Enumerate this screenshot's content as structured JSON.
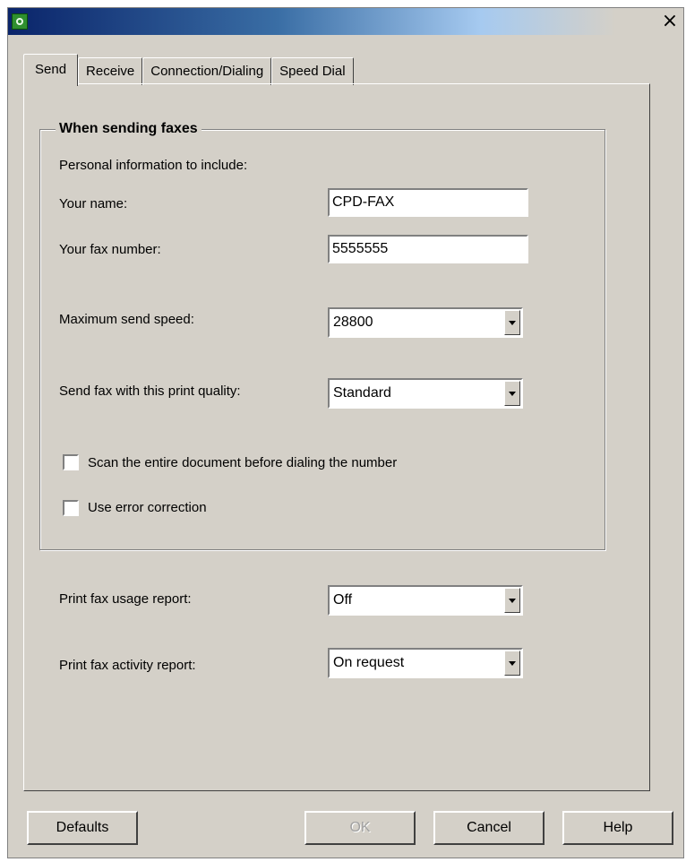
{
  "window": {
    "title": "",
    "app_icon": "fax-app-icon",
    "close_glyph": "×"
  },
  "tabs": [
    {
      "label": "Send",
      "active": true
    },
    {
      "label": "Receive",
      "active": false
    },
    {
      "label": "Connection/Dialing",
      "active": false
    },
    {
      "label": "Speed Dial",
      "active": false
    }
  ],
  "group": {
    "title": "When sending faxes",
    "personal_info_label": "Personal information to include:",
    "your_name_label": "Your name:",
    "your_name_value": "CPD-FAX",
    "fax_number_label": "Your fax number:",
    "fax_number_value": "5555555",
    "max_speed_label": "Maximum send speed:",
    "max_speed_value": "28800",
    "print_quality_label": "Send fax with this print quality:",
    "print_quality_value": "Standard",
    "scan_label": "Scan the entire document before dialing the number",
    "scan_checked": false,
    "error_correction_label": "Use error correction",
    "error_correction_checked": false
  },
  "reports": {
    "usage_label": "Print fax usage report:",
    "usage_value": "Off",
    "activity_label": "Print fax activity report:",
    "activity_value": "On request"
  },
  "buttons": {
    "defaults": "Defaults",
    "ok": "OK",
    "cancel": "Cancel",
    "help": "Help"
  },
  "colors": {
    "dialog_face": "#d4d0c8",
    "titlebar_start": "#0a246a",
    "titlebar_end": "#d4d0c8"
  }
}
